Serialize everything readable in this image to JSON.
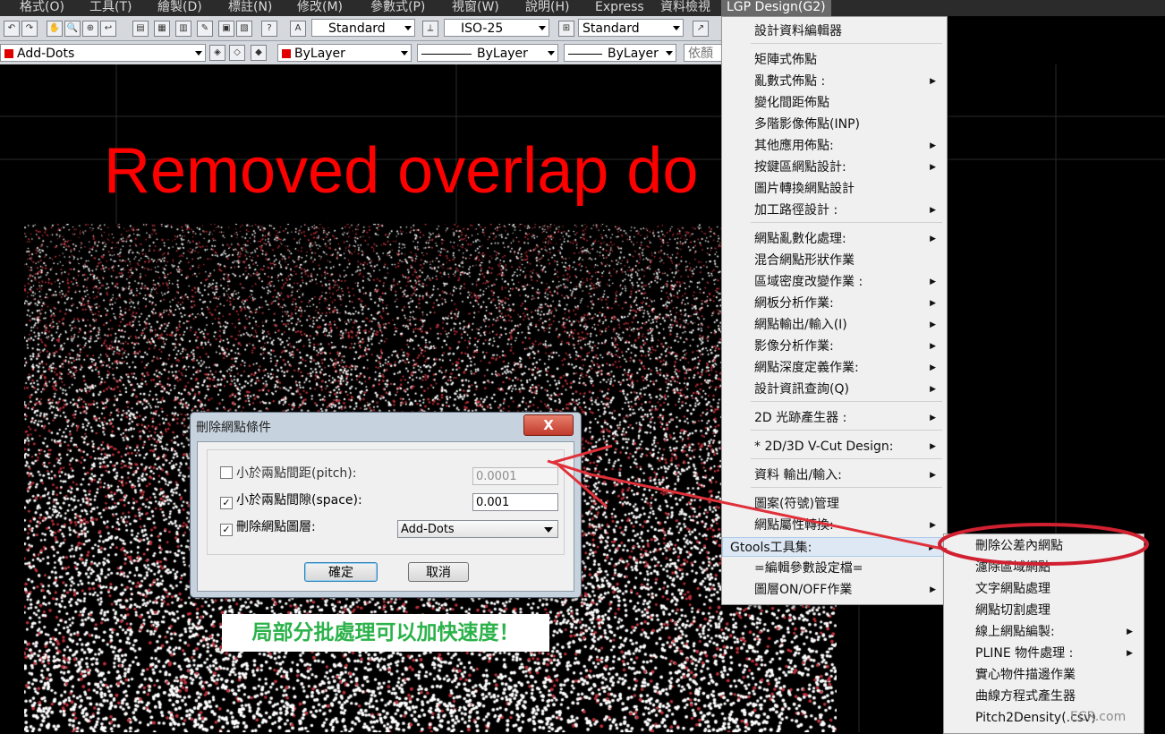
{
  "menubar": [
    "格式(O)",
    "工具(T)",
    "繪製(D)",
    "標註(N)",
    "修改(M)",
    "參數式(P)",
    "視窗(W)",
    "說明(H)",
    "Express",
    "資料檢視",
    "LGP Design(G2)"
  ],
  "toolbar": {
    "textstyle": "Standard",
    "dimstyle": "ISO-25",
    "tablestyle": "Standard",
    "layer": "Add-Dots",
    "color": "ByLayer",
    "linetype": "ByLayer",
    "lineweight": "ByLayer",
    "plotstyle": "依顏"
  },
  "canvas": {
    "title": "Removed overlap do",
    "note": "局部分批處理可以加快速度！",
    "watermark": "ECR.com"
  },
  "dialog": {
    "title": "刪除網點條件",
    "close": "X",
    "pitch_label": "小於兩點間距(pitch):",
    "pitch_value": "0.0001",
    "pitch_checked": false,
    "space_label": "小於兩點間隙(space):",
    "space_value": "0.001",
    "space_checked": true,
    "layer_label": "刪除網點圖層:",
    "layer_value": "Add-Dots",
    "layer_checked": true,
    "ok": "確定",
    "cancel": "取消"
  },
  "menu": {
    "items": [
      {
        "label": "設計資料編輯器",
        "sub": false
      },
      {
        "label": "矩陣式佈點",
        "sub": false
      },
      {
        "label": "亂數式佈點 :",
        "sub": true
      },
      {
        "label": "變化間距佈點",
        "sub": false
      },
      {
        "label": "多階影像佈點(INP)",
        "sub": false
      },
      {
        "label": "其他應用佈點:",
        "sub": true
      },
      {
        "label": "按鍵區網點設計:",
        "sub": true
      },
      {
        "label": "圖片轉換網點設計",
        "sub": false
      },
      {
        "label": "加工路徑設計 :",
        "sub": true
      },
      {
        "label": "網點亂數化處理:",
        "sub": true
      },
      {
        "label": "混合網點形狀作業",
        "sub": false
      },
      {
        "label": "區域密度改變作業 :",
        "sub": true
      },
      {
        "label": "網板分析作業:",
        "sub": true
      },
      {
        "label": "網點輸出/輸入(I)",
        "sub": true
      },
      {
        "label": "影像分析作業:",
        "sub": true
      },
      {
        "label": "網點深度定義作業:",
        "sub": true
      },
      {
        "label": "設計資訊查詢(Q)",
        "sub": true
      },
      {
        "label": "2D 光跡產生器 :",
        "sub": true
      },
      {
        "label": "* 2D/3D V-Cut Design:",
        "sub": true
      },
      {
        "label": "資料 輸出/輸入:",
        "sub": true
      },
      {
        "label": "圖案(符號)管理",
        "sub": false
      },
      {
        "label": "網點屬性轉換:",
        "sub": true
      },
      {
        "label": "Gtools工具集:",
        "sub": true
      },
      {
        "label": "=編輯參數設定檔=",
        "sub": false
      },
      {
        "label": "圖層ON/OFF作業",
        "sub": true
      }
    ]
  },
  "submenu": {
    "items": [
      {
        "label": "刪除公差內網點",
        "sub": false
      },
      {
        "label": "濾除區域網點",
        "sub": false
      },
      {
        "label": "文字網點處理",
        "sub": false
      },
      {
        "label": "網點切割處理",
        "sub": false
      },
      {
        "label": "線上網點編製:",
        "sub": true
      },
      {
        "label": "PLINE 物件處理 :",
        "sub": true
      },
      {
        "label": "實心物件描邊作業",
        "sub": false
      },
      {
        "label": "曲線方程式產生器",
        "sub": false
      },
      {
        "label": "Pitch2Density(.csv)",
        "sub": false
      }
    ]
  },
  "colors": {
    "title": "#ff0000",
    "note": "#2bb24a",
    "callout": "#e0303a",
    "accent": "#3c7fb1"
  }
}
